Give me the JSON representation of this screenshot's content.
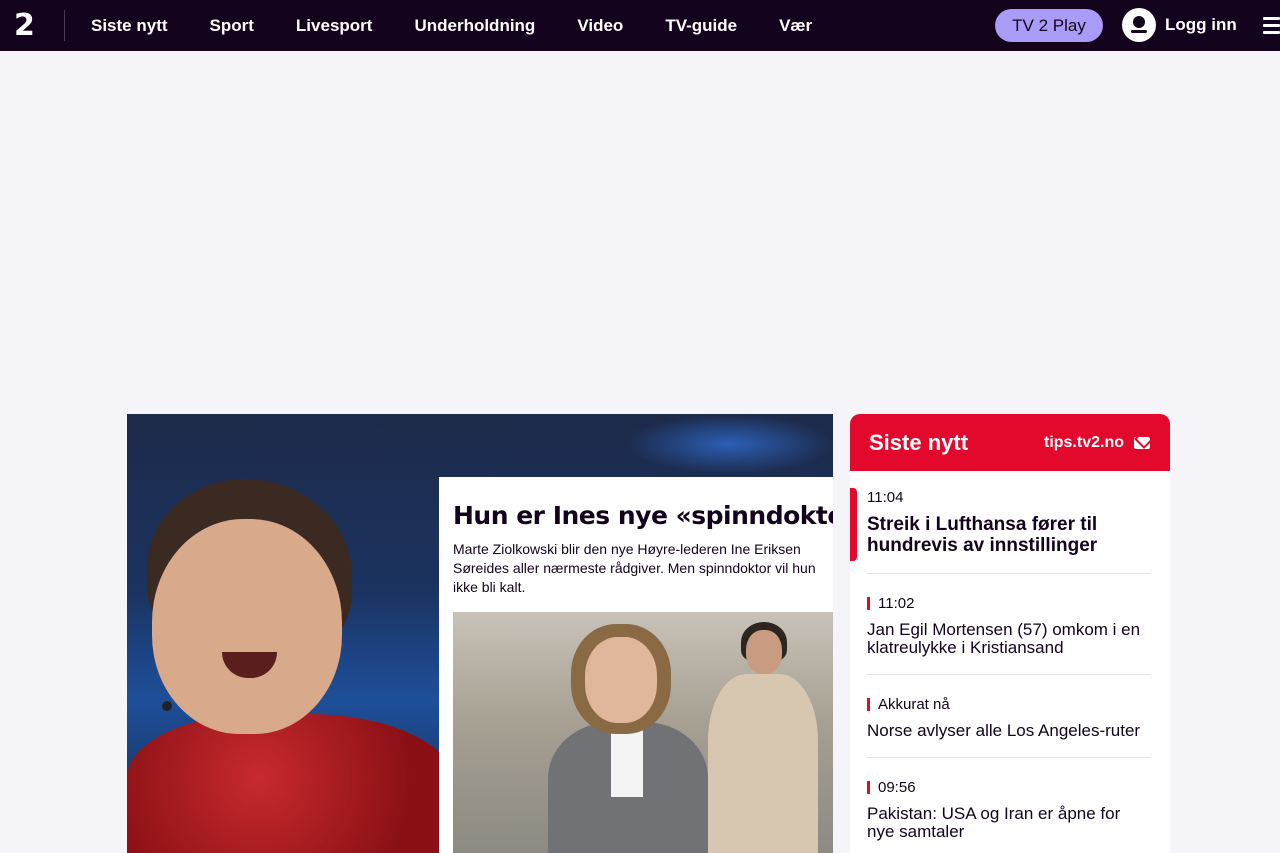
{
  "header": {
    "logo_text": "2",
    "nav": [
      "Siste nytt",
      "Sport",
      "Livesport",
      "Underholdning",
      "Video",
      "TV-guide",
      "Vær"
    ],
    "play_label": "TV 2 Play",
    "login_label": "Logg inn"
  },
  "colors": {
    "header_bg": "#13031c",
    "accent_red": "#e3092c",
    "play_purple": "#a99cf6",
    "page_bg": "#f5f4f9"
  },
  "hero": {
    "title": "Hun er Ines nye «spinndoktor",
    "lead": "Marte Ziolkowski blir den nye Høyre-lederen Ine Eriksen Søreides aller nærmeste rådgiver. Men spinndoktor vil hun ikke bli kalt."
  },
  "news": {
    "title": "Siste nytt",
    "tips_label": "tips.tv2.no",
    "items": [
      {
        "time": "11:04",
        "text": "Streik i Lufthansa fører til hundrevis av innstillinger"
      },
      {
        "time": "11:02",
        "text": "Jan Egil Mortensen (57) omkom i en klatreulykke i Kristiansand"
      },
      {
        "time": "Akkurat nå",
        "text": "Norse avlyser alle Los Angeles-ruter"
      },
      {
        "time": "09:56",
        "text": "Pakistan: USA og Iran er åpne for nye samtaler"
      }
    ]
  },
  "icons": [
    "tv2-logo-icon",
    "user-avatar-icon",
    "menu-icon",
    "mail-icon"
  ]
}
